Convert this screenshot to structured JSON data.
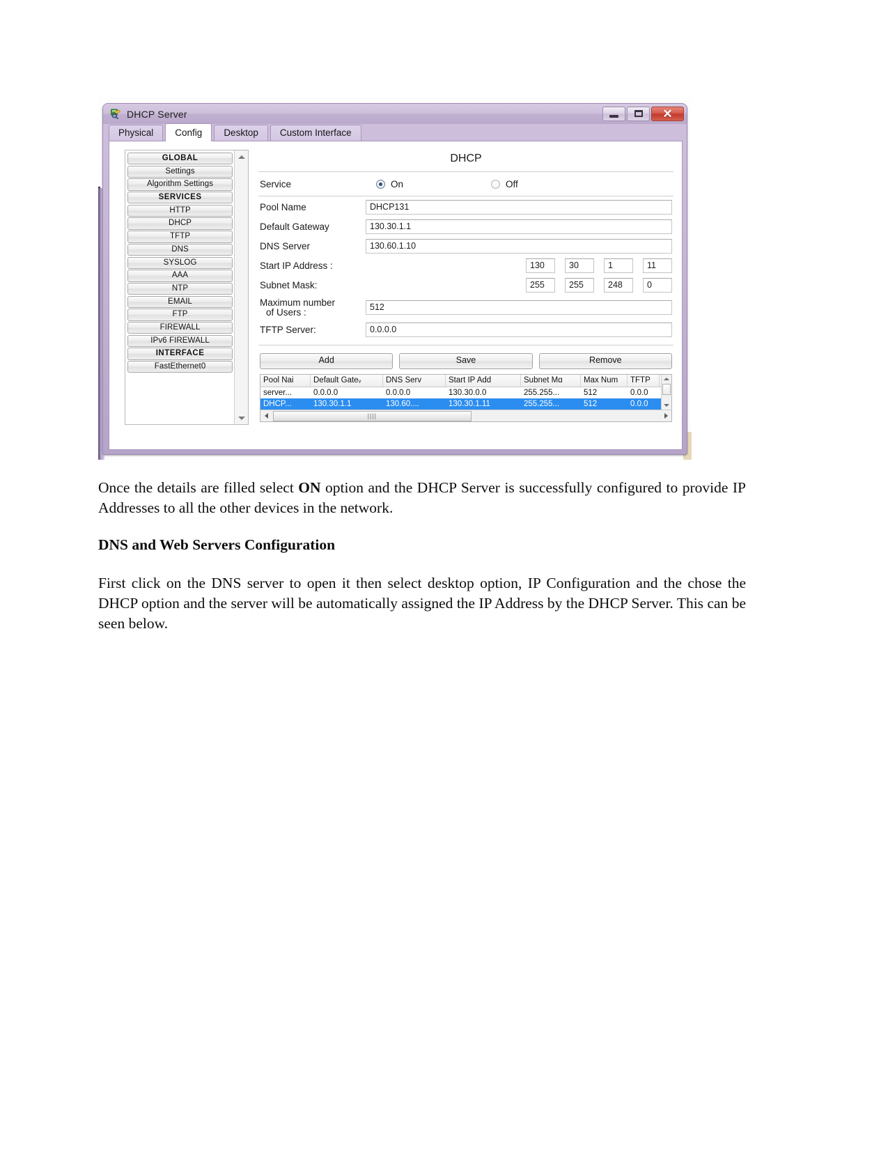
{
  "window": {
    "title": "DHCP Server",
    "icon": "server-magnifier-icon",
    "controls": {
      "minimize": "minimize-button",
      "maximize": "maximize-button",
      "close_glyph": "✕"
    }
  },
  "tabs": [
    {
      "label": "Physical",
      "active": false
    },
    {
      "label": "Config",
      "active": true
    },
    {
      "label": "Desktop",
      "active": false
    },
    {
      "label": "Custom Interface",
      "active": false
    }
  ],
  "sidebar": {
    "items": [
      {
        "label": "GLOBAL",
        "header": true
      },
      {
        "label": "Settings",
        "header": false
      },
      {
        "label": "Algorithm Settings",
        "header": false
      },
      {
        "label": "SERVICES",
        "header": true
      },
      {
        "label": "HTTP",
        "header": false
      },
      {
        "label": "DHCP",
        "header": false
      },
      {
        "label": "TFTP",
        "header": false
      },
      {
        "label": "DNS",
        "header": false
      },
      {
        "label": "SYSLOG",
        "header": false
      },
      {
        "label": "AAA",
        "header": false
      },
      {
        "label": "NTP",
        "header": false
      },
      {
        "label": "EMAIL",
        "header": false
      },
      {
        "label": "FTP",
        "header": false
      },
      {
        "label": "FIREWALL",
        "header": false
      },
      {
        "label": "IPv6 FIREWALL",
        "header": false
      },
      {
        "label": "INTERFACE",
        "header": true
      },
      {
        "label": "FastEthernet0",
        "header": false
      }
    ]
  },
  "form": {
    "title": "DHCP",
    "service_label": "Service",
    "service_on_label": "On",
    "service_off_label": "Off",
    "service_value": "On",
    "pool_name_label": "Pool Name",
    "pool_name_value": "DHCP131",
    "default_gateway_label": "Default Gateway",
    "default_gateway_value": "130.30.1.1",
    "dns_server_label": "DNS Server",
    "dns_server_value": "130.60.1.10",
    "start_ip_label": "Start IP Address :",
    "start_ip_octets": [
      "130",
      "30",
      "1",
      "11"
    ],
    "subnet_mask_label": "Subnet Mask:",
    "subnet_mask_octets": [
      "255",
      "255",
      "248",
      "0"
    ],
    "max_users_label_line1": "Maximum number",
    "max_users_label_line2": "of Users :",
    "max_users_value": "512",
    "tftp_server_label": "TFTP Server:",
    "tftp_server_value": "0.0.0.0",
    "buttons": {
      "add": "Add",
      "save": "Save",
      "remove": "Remove"
    }
  },
  "table": {
    "columns": [
      "Pool Nai",
      "Default Gateᵥ",
      "DNS Serv",
      "Start IP Add",
      "Subnet Mɑ",
      "Max Num",
      "TFTP"
    ],
    "rows": [
      {
        "selected": false,
        "cells": [
          "server...",
          "0.0.0.0",
          "0.0.0.0",
          "130.30.0.0",
          "255.255...",
          "512",
          "0.0.0"
        ]
      },
      {
        "selected": true,
        "cells": [
          "DHCP...",
          "130.30.1.1",
          "130.60....",
          "130.30.1.11",
          "255.255...",
          "512",
          "0.0.0"
        ]
      }
    ]
  },
  "document": {
    "paragraph_1_pre": "Once the details are filled select ",
    "paragraph_1_bold": "ON",
    "paragraph_1_post": " option and the DHCP Server is successfully configured to provide IP Addresses to all the other devices in the network.",
    "heading_1": "DNS and Web Servers Configuration",
    "paragraph_2": "First click on the DNS server to open it then select desktop option, IP Configuration and the chose the DHCP option and the server will be automatically assigned the IP Address by the DHCP Server. This can be seen below."
  }
}
